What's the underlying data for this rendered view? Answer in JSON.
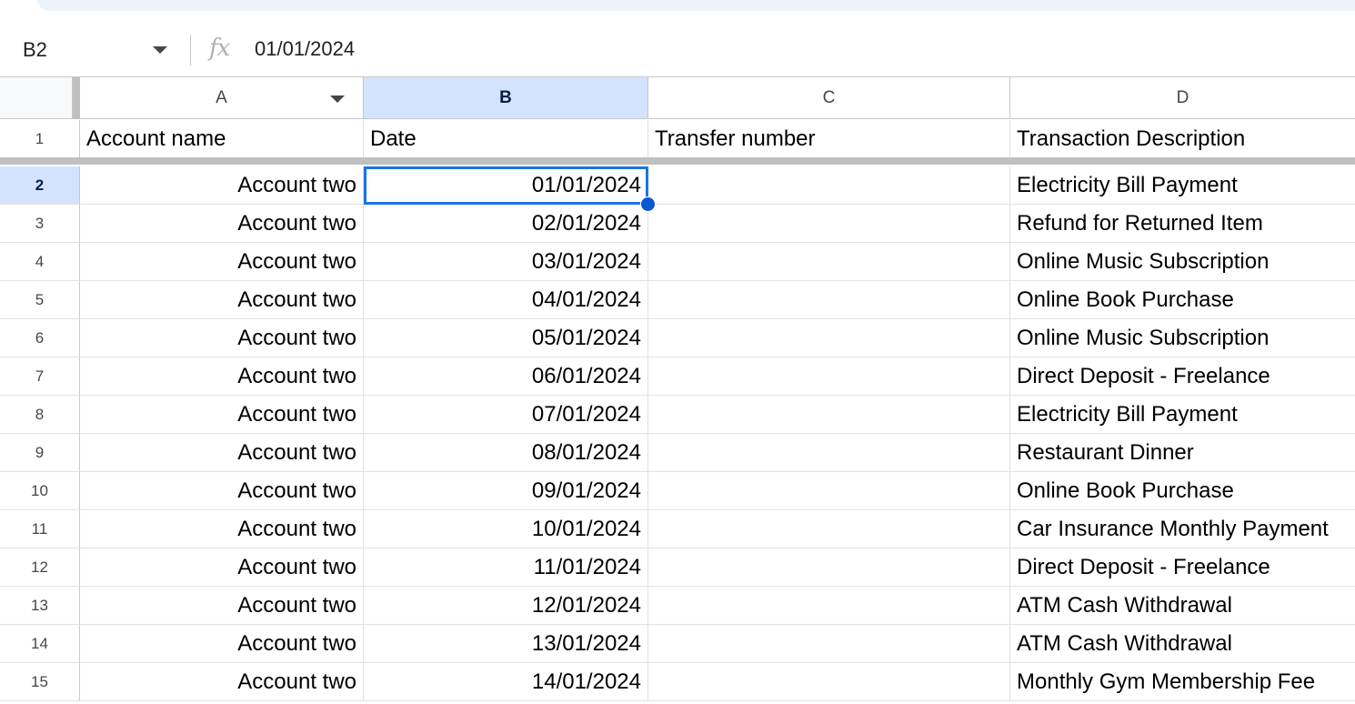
{
  "formula_bar": {
    "name_box": "B2",
    "fx_label": "fx",
    "formula": "01/01/2024"
  },
  "columns": [
    {
      "letter": "A",
      "selected": false
    },
    {
      "letter": "B",
      "selected": true
    },
    {
      "letter": "C",
      "selected": false
    },
    {
      "letter": "D",
      "selected": false
    }
  ],
  "header_row": {
    "number": "1",
    "cells": [
      "Account name",
      "Date",
      "Transfer number",
      "Transaction Description"
    ]
  },
  "rows": [
    {
      "number": "2",
      "account": "Account two",
      "date": "01/01/2024",
      "transfer": "",
      "description": "Electricity Bill Payment"
    },
    {
      "number": "3",
      "account": "Account two",
      "date": "02/01/2024",
      "transfer": "",
      "description": "Refund for Returned Item"
    },
    {
      "number": "4",
      "account": "Account two",
      "date": "03/01/2024",
      "transfer": "",
      "description": "Online Music Subscription"
    },
    {
      "number": "5",
      "account": "Account two",
      "date": "04/01/2024",
      "transfer": "",
      "description": "Online Book Purchase"
    },
    {
      "number": "6",
      "account": "Account two",
      "date": "05/01/2024",
      "transfer": "",
      "description": "Online Music Subscription"
    },
    {
      "number": "7",
      "account": "Account two",
      "date": "06/01/2024",
      "transfer": "",
      "description": "Direct Deposit - Freelance"
    },
    {
      "number": "8",
      "account": "Account two",
      "date": "07/01/2024",
      "transfer": "",
      "description": "Electricity Bill Payment"
    },
    {
      "number": "9",
      "account": "Account two",
      "date": "08/01/2024",
      "transfer": "",
      "description": "Restaurant Dinner"
    },
    {
      "number": "10",
      "account": "Account two",
      "date": "09/01/2024",
      "transfer": "",
      "description": "Online Book Purchase"
    },
    {
      "number": "11",
      "account": "Account two",
      "date": "10/01/2024",
      "transfer": "",
      "description": "Car Insurance Monthly Payment"
    },
    {
      "number": "12",
      "account": "Account two",
      "date": "11/01/2024",
      "transfer": "",
      "description": "Direct Deposit - Freelance"
    },
    {
      "number": "13",
      "account": "Account two",
      "date": "12/01/2024",
      "transfer": "",
      "description": "ATM Cash Withdrawal"
    },
    {
      "number": "14",
      "account": "Account two",
      "date": "13/01/2024",
      "transfer": "",
      "description": "ATM Cash Withdrawal"
    },
    {
      "number": "15",
      "account": "Account two",
      "date": "14/01/2024",
      "transfer": "",
      "description": "Monthly Gym Membership Fee"
    }
  ],
  "selection": {
    "cell": "B2"
  },
  "colors": {
    "selection_border": "#1a73e8",
    "selected_header_bg": "#d3e3fd",
    "gridline": "#e1e1e1",
    "freeze_bar": "#c0c0c0"
  }
}
